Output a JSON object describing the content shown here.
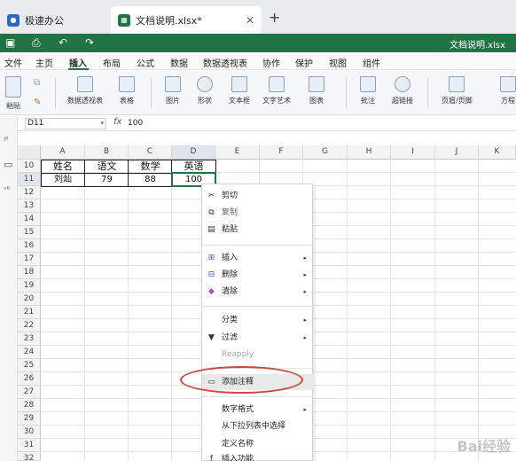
{
  "browser_tabs": [
    {
      "label": "极速办公"
    },
    {
      "label": "文档说明.xlsx*"
    }
  ],
  "titlebar": {
    "doc_name": "文档说明.xlsx"
  },
  "menu": [
    "文件",
    "主页",
    "插入",
    "布局",
    "公式",
    "数据",
    "数据透视表",
    "协作",
    "保护",
    "视图",
    "组件"
  ],
  "active_menu": "插入",
  "ribbon": [
    "粘贴",
    "数据透视表",
    "表格",
    "图片",
    "形状",
    "文本框",
    "文字艺术",
    "图表",
    "批注",
    "超链接",
    "页眉/页脚",
    "方程"
  ],
  "formula_bar": {
    "cell_ref": "D11",
    "fx": "fx",
    "value": "100"
  },
  "columns": [
    "A",
    "B",
    "C",
    "D",
    "E",
    "F",
    "G",
    "H",
    "I",
    "J",
    "K"
  ],
  "rows": [
    "10",
    "11",
    "12",
    "13",
    "14",
    "15",
    "16",
    "17",
    "18",
    "19",
    "20",
    "21",
    "22",
    "23",
    "24",
    "25",
    "26",
    "27",
    "28",
    "29",
    "30",
    "31",
    "32"
  ],
  "table": {
    "headers": [
      "姓名",
      "语文",
      "数学",
      "英语"
    ],
    "row": [
      "刘灿",
      "79",
      "88",
      "100"
    ]
  },
  "context_menu": [
    {
      "label": "剪切",
      "icon": "scissors-icon"
    },
    {
      "label": "复制",
      "icon": "copy-icon"
    },
    {
      "label": "粘贴",
      "icon": "paste-icon"
    },
    {
      "label": "插入",
      "icon": "insert-icon",
      "submenu": true
    },
    {
      "label": "删除",
      "icon": "delete-icon",
      "submenu": true
    },
    {
      "label": "清除",
      "icon": "eraser-icon",
      "submenu": true
    },
    {
      "label": "分类",
      "submenu": true
    },
    {
      "label": "过滤",
      "icon": "filter-icon",
      "submenu": true
    },
    {
      "label": "Reapply",
      "disabled": true
    },
    {
      "label": "添加注释",
      "icon": "comment-icon",
      "highlighted": true
    },
    {
      "label": "数字格式",
      "submenu": true
    },
    {
      "label": "从下拉列表中选择"
    },
    {
      "label": "定义名称"
    },
    {
      "label": "插入功能"
    }
  ],
  "watermark": "Bai经验",
  "colors": {
    "brand_green": "#217346",
    "highlight_ellipse": "#d2473b"
  }
}
